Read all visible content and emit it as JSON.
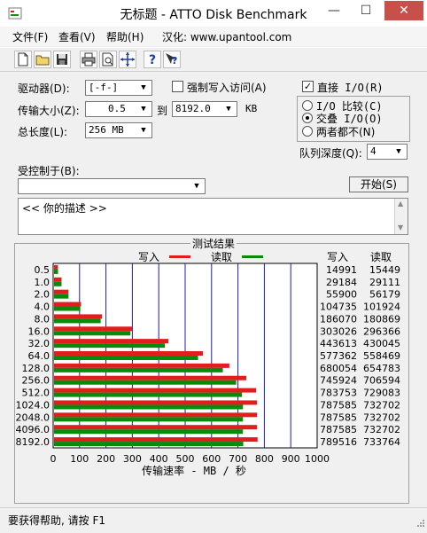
{
  "window": {
    "title": "无标题 - ATTO Disk Benchmark",
    "minimize": "—",
    "maximize": "☐",
    "close": "✕"
  },
  "menu": {
    "file": "文件(F)",
    "view": "查看(V)",
    "help": "帮助(H)",
    "localization": "汉化: www.upantool.com"
  },
  "toolbar": {
    "icons": [
      "new-document-icon",
      "open-folder-icon",
      "save-icon",
      "print-icon",
      "print-preview-icon",
      "move-icon",
      "help-icon",
      "context-help-icon"
    ]
  },
  "settings": {
    "drive_label": "驱动器(D):",
    "drive_value": "[-f-]",
    "transfer_label": "传输大小(Z):",
    "transfer_from": "0.5",
    "transfer_to_label": "到",
    "transfer_to": "8192.0",
    "transfer_unit": "KB",
    "length_label": "总长度(L):",
    "length_value": "256 MB",
    "force_write_label": "强制写入访问(A)",
    "force_write_checked": false,
    "direct_io_label": "直接 I/O(R)",
    "direct_io_checked": true,
    "io_compare_label": "I/O 比较(C)",
    "overlapped_io_label": "交叠 I/O(O)",
    "neither_label": "两者都不(N)",
    "io_mode_selected": "overlapped",
    "queue_depth_label": "队列深度(Q):",
    "queue_depth_value": "4",
    "controlled_by_label": "受控制于(B):",
    "controlled_by_value": "",
    "start_button": "开始(S)",
    "description": "<<   你的描述   >>"
  },
  "results": {
    "title": "测试结果",
    "write_label": "写入",
    "read_label": "读取",
    "col_write": "写入",
    "col_read": "读取",
    "write_color": "#e11d1d",
    "read_color": "#0a8a0a",
    "rows": [
      {
        "size": "0.5",
        "write": "14991",
        "read": "15449"
      },
      {
        "size": "1.0",
        "write": "29184",
        "read": "29111"
      },
      {
        "size": "2.0",
        "write": "55900",
        "read": "56179"
      },
      {
        "size": "4.0",
        "write": "104735",
        "read": "101924"
      },
      {
        "size": "8.0",
        "write": "186070",
        "read": "180869"
      },
      {
        "size": "16.0",
        "write": "303026",
        "read": "296366"
      },
      {
        "size": "32.0",
        "write": "443613",
        "read": "430045"
      },
      {
        "size": "64.0",
        "write": "577362",
        "read": "558469"
      },
      {
        "size": "128.0",
        "write": "680054",
        "read": "654783"
      },
      {
        "size": "256.0",
        "write": "745924",
        "read": "706594"
      },
      {
        "size": "512.0",
        "write": "783753",
        "read": "729083"
      },
      {
        "size": "1024.0",
        "write": "787585",
        "read": "732702"
      },
      {
        "size": "2048.0",
        "write": "787585",
        "read": "732702"
      },
      {
        "size": "4096.0",
        "write": "787585",
        "read": "732702"
      },
      {
        "size": "8192.0",
        "write": "789516",
        "read": "733764"
      }
    ]
  },
  "chart_data": {
    "type": "bar",
    "orientation": "horizontal",
    "categories": [
      "0.5",
      "1.0",
      "2.0",
      "4.0",
      "8.0",
      "16.0",
      "32.0",
      "64.0",
      "128.0",
      "256.0",
      "512.0",
      "1024.0",
      "2048.0",
      "4096.0",
      "8192.0"
    ],
    "series": [
      {
        "name": "写入",
        "color": "#e11d1d",
        "values": [
          14.6,
          28.5,
          54.6,
          102.3,
          181.7,
          295.9,
          433.2,
          563.8,
          664.1,
          728.4,
          765.4,
          769.1,
          769.1,
          769.1,
          771.0
        ]
      },
      {
        "name": "读取",
        "color": "#0a8a0a",
        "values": [
          15.1,
          28.4,
          54.9,
          99.5,
          176.6,
          289.4,
          420.0,
          545.4,
          639.4,
          690.0,
          712.0,
          715.5,
          715.5,
          715.5,
          716.6
        ]
      }
    ],
    "xlim": [
      0,
      1000
    ],
    "xticks": [
      "0",
      "100",
      "200",
      "300",
      "400",
      "500",
      "600",
      "700",
      "800",
      "900",
      "1000"
    ],
    "xlabel": "传输速率 - MB / 秒",
    "grid": true
  },
  "status": {
    "text": "要获得帮助, 请按 F1"
  }
}
